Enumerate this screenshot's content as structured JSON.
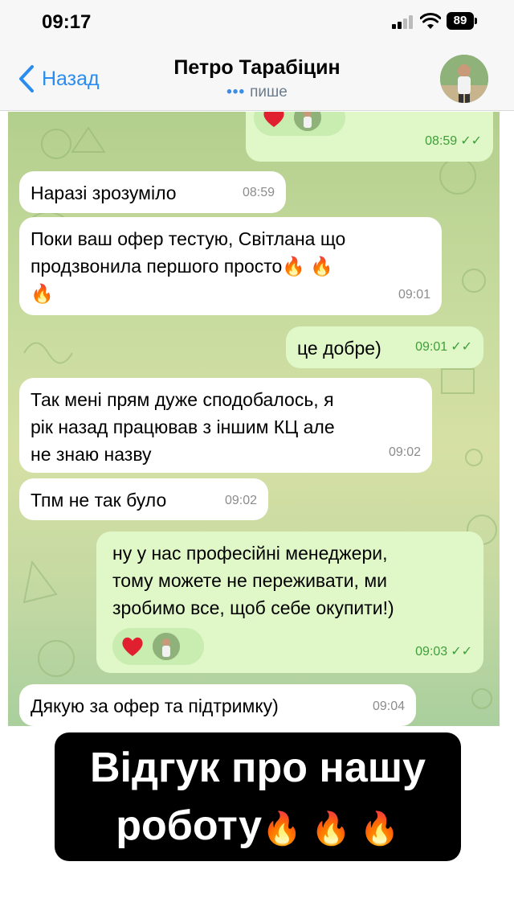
{
  "status_bar": {
    "time": "09:17",
    "battery": "89"
  },
  "header": {
    "back_label": "Назад",
    "contact_name": "Петро Тарабіцин",
    "typing_dots": "•••",
    "status": "пише"
  },
  "messages": [
    {
      "direction": "out",
      "text": "",
      "time": "08:59",
      "read": "✓✓",
      "reactions": [
        "heart"
      ]
    },
    {
      "direction": "in",
      "text": "Наразі зрозуміло",
      "time": "08:59"
    },
    {
      "direction": "in",
      "lines": [
        "Поки ваш офер тестую, Світлана що",
        "продзвонила першого просто🔥 🔥",
        "🔥"
      ],
      "time": "09:01"
    },
    {
      "direction": "out",
      "text": "це добре)",
      "time": "09:01",
      "read": "✓✓"
    },
    {
      "direction": "in",
      "lines": [
        "Так мені прям дуже сподобалось, я",
        "рік назад працював з іншим КЦ але",
        "не знаю назву"
      ],
      "time": "09:02"
    },
    {
      "direction": "in",
      "text": "Тпм не так було",
      "time": "09:02"
    },
    {
      "direction": "out",
      "lines": [
        "ну у нас професійні менеджери,",
        "тому можете не переживати, ми",
        "зробимо все, щоб себе окупити!)"
      ],
      "time": "09:03",
      "read": "✓✓",
      "reactions": [
        "heart"
      ]
    },
    {
      "direction": "in",
      "text": "Дякую за офер та підтримку)",
      "time": "09:04"
    }
  ],
  "caption": {
    "line1": "Відгук про нашу",
    "line2": "роботу",
    "fire": "🔥 🔥 🔥"
  },
  "colors": {
    "accent": "#2a8cf0",
    "outgoing": "#e0f8c8",
    "incoming": "#ffffff",
    "read_check": "#3f9e3a",
    "heart": "#e0202f"
  }
}
